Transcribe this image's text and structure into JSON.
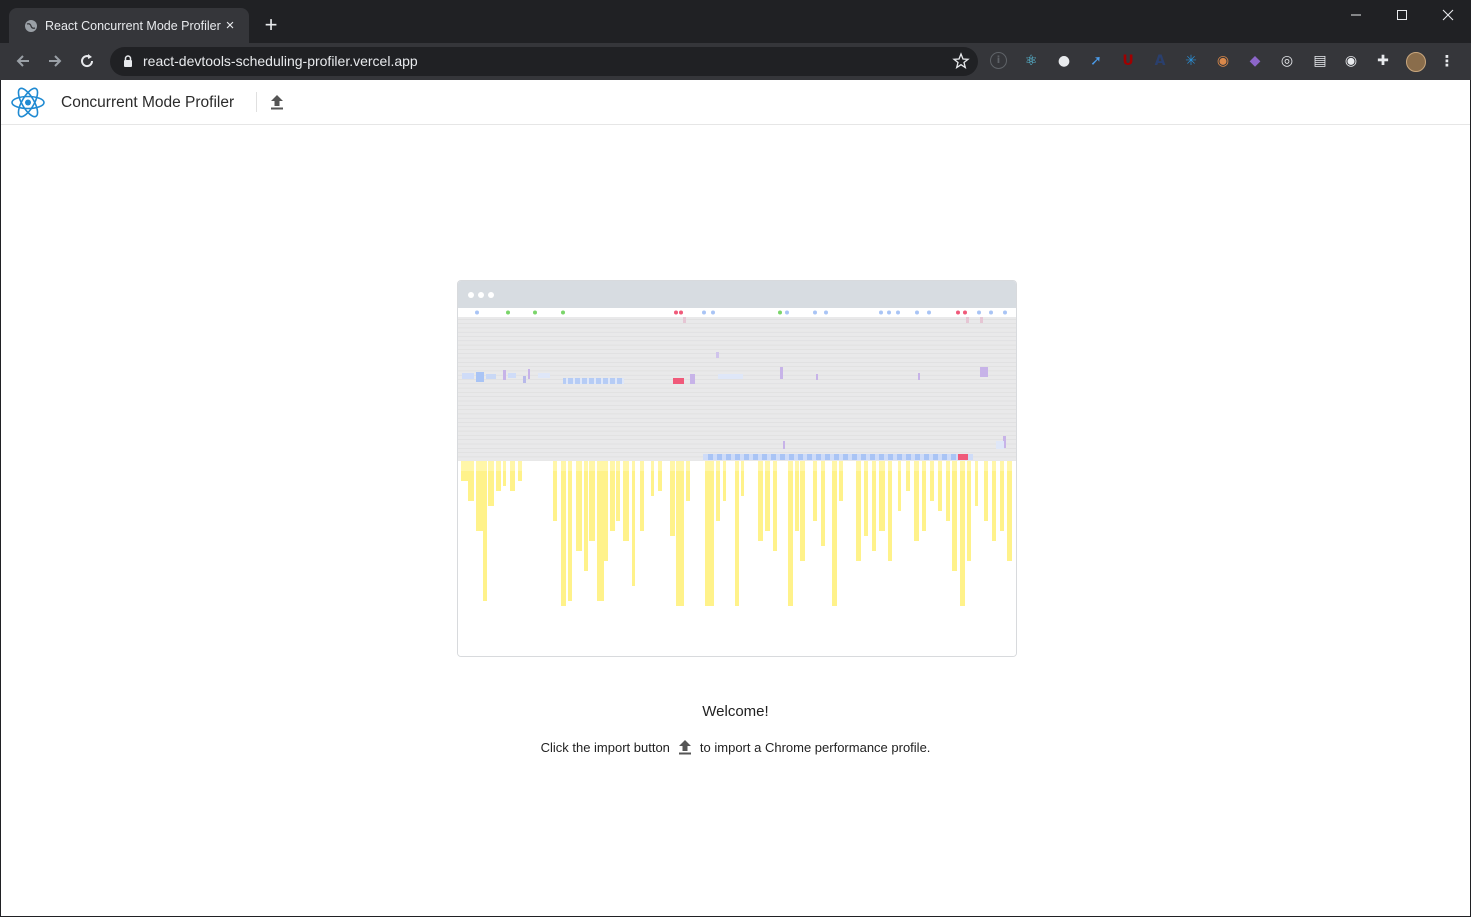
{
  "browser": {
    "tab": {
      "title": "React Concurrent Mode Profiler",
      "favicon": "globe-icon",
      "close": "×"
    },
    "new_tab": "+",
    "url": "react-devtools-scheduling-profiler.vercel.app",
    "extensions": [
      {
        "name": "info-icon",
        "color": "#5f6368",
        "glyph": "i"
      },
      {
        "name": "react-devtools-icon",
        "color": "#61dafb",
        "glyph": "⚛"
      },
      {
        "name": "eyedropper-icon",
        "color": "#e8eaed",
        "glyph": "●"
      },
      {
        "name": "compass-icon",
        "color": "#4b9be8",
        "glyph": "➚"
      },
      {
        "name": "ublock-icon",
        "color": "#a00000",
        "glyph": "U"
      },
      {
        "name": "a-icon",
        "color": "#2a3f6d",
        "glyph": "A"
      },
      {
        "name": "graph-icon",
        "color": "#2a8fd6",
        "glyph": "✳"
      },
      {
        "name": "face-icon",
        "color": "#d9884a",
        "glyph": "◉"
      },
      {
        "name": "cat-icon",
        "color": "#8c66c9",
        "glyph": "◆"
      },
      {
        "name": "target-icon",
        "color": "#e8eaed",
        "glyph": "◎"
      },
      {
        "name": "document-icon",
        "color": "#e8eaed",
        "glyph": "▤"
      },
      {
        "name": "record-icon",
        "color": "#e8eaed",
        "glyph": "◉"
      },
      {
        "name": "puzzle-icon",
        "color": "#e8eaed",
        "glyph": "✚"
      },
      {
        "name": "avatar",
        "color": "#8a6d4b",
        "glyph": ""
      },
      {
        "name": "more-icon",
        "color": "#e8eaed",
        "glyph": "⋮"
      }
    ]
  },
  "app": {
    "title": "Concurrent Mode Profiler",
    "logo": "react-logo-icon",
    "import_button": "upload-icon"
  },
  "welcome": {
    "heading": "Welcome!",
    "text_before": "Click the import button",
    "text_after": "to import a Chrome performance profile."
  },
  "colors": {
    "react_blue": "#1f8ad2",
    "flame_yellow": "#fff28a",
    "event_blue": "#a9c4f5",
    "event_pink": "#f05a7a",
    "event_green": "#7bd56a",
    "lane_gray": "#ebebeb"
  }
}
